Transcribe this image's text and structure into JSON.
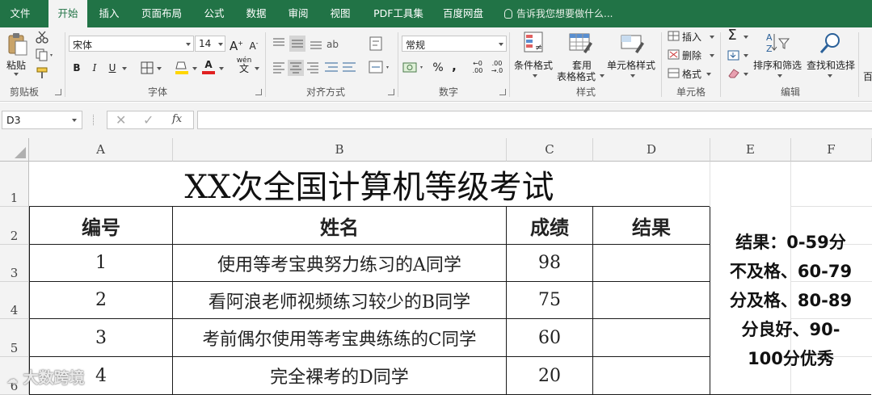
{
  "menu": {
    "tabs": [
      {
        "label": "文件"
      },
      {
        "label": "开始"
      },
      {
        "label": "插入"
      },
      {
        "label": "页面布局"
      },
      {
        "label": "公式"
      },
      {
        "label": "数据"
      },
      {
        "label": "审阅"
      },
      {
        "label": "视图"
      },
      {
        "label": "PDF工具集"
      },
      {
        "label": "百度网盘"
      }
    ],
    "active_tab": "开始",
    "tell_me": "告诉我您想要做什么..."
  },
  "ribbon": {
    "clipboard": {
      "paste": "粘贴",
      "group": "剪贴板"
    },
    "font": {
      "name": "宋体",
      "size": "14",
      "bold": "B",
      "italic": "I",
      "underline": "U",
      "font_color": "A",
      "phonetic": "wén",
      "group": "字体"
    },
    "alignment": {
      "group": "对齐方式"
    },
    "number": {
      "format": "常规",
      "percent": "%",
      "comma": ",",
      "group": "数字"
    },
    "styles": {
      "conditional": "条件格式",
      "table_line1": "套用",
      "table_line2": "表格格式",
      "cell_styles": "单元格样式",
      "group": "样式"
    },
    "cells": {
      "insert": "插入",
      "delete": "删除",
      "format": "格式",
      "group": "单元格"
    },
    "editing": {
      "sum": "Σ",
      "sort_filter": "排序和筛选",
      "find_select": "查找和选择",
      "group": "编辑"
    },
    "cut_off": "百"
  },
  "formula_bar": {
    "name_box": "D3",
    "fx": "fx",
    "value": ""
  },
  "sheet": {
    "columns": [
      "A",
      "B",
      "C",
      "D",
      "E",
      "F"
    ],
    "rows": [
      "1",
      "2",
      "3",
      "4",
      "5",
      "6"
    ],
    "title": "XX次全国计算机等级考试",
    "headers": [
      "编号",
      "姓名",
      "成绩",
      "结果"
    ],
    "data": [
      {
        "id": "1",
        "name": "使用等考宝典努力练习的A同学",
        "score": "98",
        "result": ""
      },
      {
        "id": "2",
        "name": "看阿浪老师视频练习较少的B同学",
        "score": "75",
        "result": ""
      },
      {
        "id": "3",
        "name": "考前偶尔使用等考宝典练练的C同学",
        "score": "60",
        "result": ""
      },
      {
        "id": "4",
        "name": "完全裸考的D同学",
        "score": "20",
        "result": ""
      }
    ],
    "note": "结果：0-59分不及格、60-79分及格、80-89分良好、90-100分优秀",
    "note_lines": [
      "结果：0-59分",
      "不及格、60-79",
      "分及格、80-89",
      "分良好、90-",
      "100分优秀"
    ]
  },
  "watermark": "大数跨境"
}
